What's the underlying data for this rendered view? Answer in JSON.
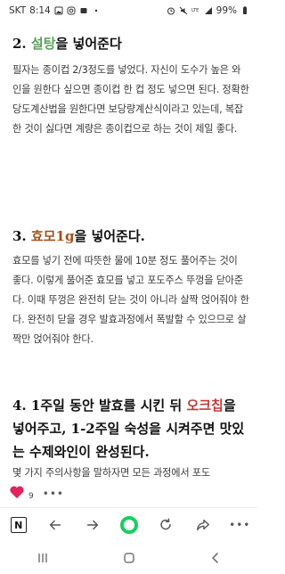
{
  "status_bar": {
    "carrier": "SKT",
    "time": "8:14",
    "battery": "99%"
  },
  "article": {
    "section2": {
      "num": "2.",
      "highlight": "설탕",
      "rest": "을 넣어준다",
      "paragraph": "필자는 종이컵 2/3정도를 넣었다. 자신이 도수가 높은 와인을 원한다 싶으면 종이컵 한 컵 정도 넣으면 된다. 정확한 당도계산법을 원한다면 보당량계산식이라고 있는데, 복잡한 것이 싫다면 계량은 종이컵으로 하는 것이 제일 좋다."
    },
    "section3": {
      "num": "3.",
      "highlight": "효모1g",
      "rest": "을 넣어준다.",
      "paragraph": "효모를 넣기 전에 따뜻한 물에 10분 정도 풀어주는 것이 좋다. 이렇게 풀어준 효모를 넣고 포도주스 뚜껑을 닫아준다. 이때 뚜껑은 완전히 닫는 것이 아니라 살짝 얹어줘야 한다. 완전히 닫을 경우 발효과정에서 폭발할 수 있으므로 살짝만 얹어줘야 한다."
    },
    "section4": {
      "prefix": "4. 1주일 동안 발효를 시킨 뒤 ",
      "highlight": "오크칩",
      "rest": "을 넣어주고, 1-2주일 숙성을 시켜주면 맛있는 수제와인이 완성된다.",
      "paragraph_partial": "몇 가지 주의사항을 말하자면 모든 과정에서 포도"
    }
  },
  "reaction_bar": {
    "like_count": "9",
    "more": "•••"
  },
  "toolbar": {
    "items": [
      "naver-home",
      "back",
      "forward",
      "home",
      "refresh",
      "share",
      "more"
    ],
    "more_label": "•••"
  },
  "colors": {
    "green_highlight": "#5aa05a",
    "brown_highlight": "#a0521d",
    "red_highlight": "#c23a3a",
    "naver_green": "#19ce60",
    "heart": "#e0245e"
  }
}
